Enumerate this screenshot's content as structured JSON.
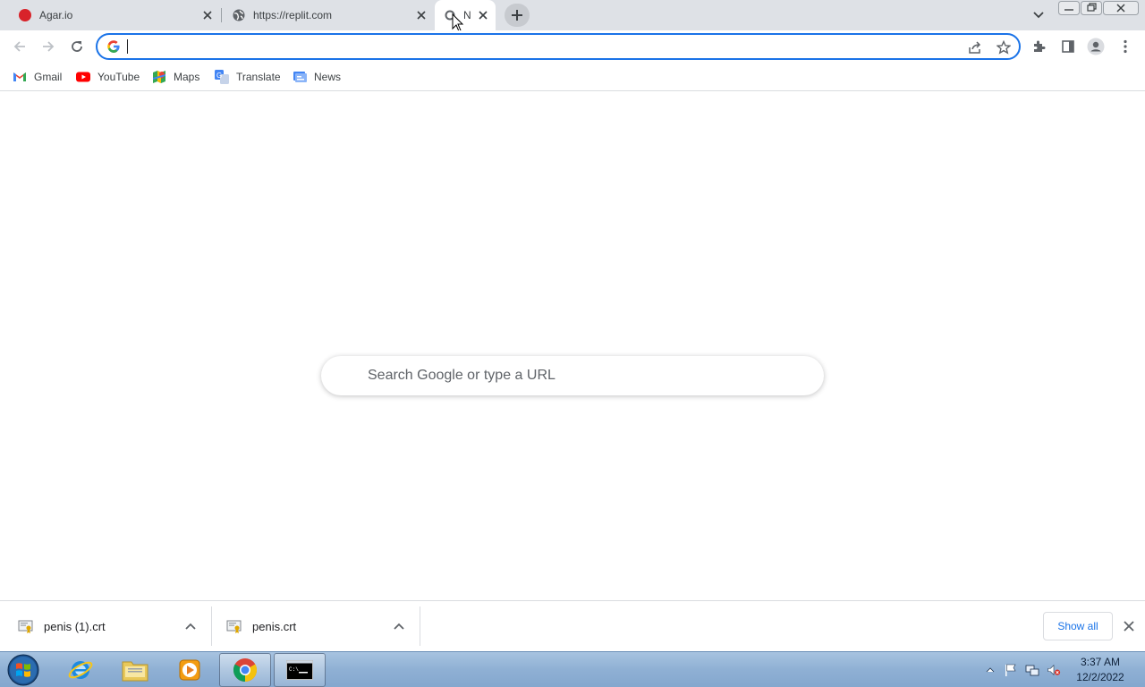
{
  "browser": {
    "tabs": [
      {
        "title": "Agar.io",
        "icon": "agar-icon",
        "active": false
      },
      {
        "title": "https://replit.com",
        "icon": "globe-icon",
        "active": false
      },
      {
        "title": "N",
        "icon": "new-tab-loading-icon",
        "active": true
      }
    ],
    "omnibox": {
      "value": "",
      "placeholder": ""
    },
    "bookmarks": [
      {
        "label": "Gmail",
        "icon": "gmail-icon"
      },
      {
        "label": "YouTube",
        "icon": "youtube-icon"
      },
      {
        "label": "Maps",
        "icon": "maps-icon"
      },
      {
        "label": "Translate",
        "icon": "translate-icon"
      },
      {
        "label": "News",
        "icon": "news-icon"
      }
    ]
  },
  "ntp": {
    "search_placeholder": "Search Google or type a URL"
  },
  "downloads": {
    "items": [
      {
        "name": "penis (1).crt",
        "icon": "certificate-icon"
      },
      {
        "name": "penis.crt",
        "icon": "certificate-icon"
      }
    ],
    "show_all": "Show all"
  },
  "taskbar": {
    "apps": [
      {
        "name": "internet-explorer",
        "icon": "ie-icon"
      },
      {
        "name": "file-explorer",
        "icon": "folder-icon"
      },
      {
        "name": "media-player",
        "icon": "media-player-icon"
      },
      {
        "name": "chrome",
        "icon": "chrome-icon",
        "open": true
      },
      {
        "name": "command-prompt",
        "icon": "cmd-icon",
        "open": true
      }
    ],
    "clock": {
      "time": "3:37 AM",
      "date": "12/2/2022"
    }
  },
  "colors": {
    "accent": "#1a73e8",
    "tabstrip": "#dee1e6",
    "agar_red": "#d8232a",
    "youtube_red": "#ff0000"
  }
}
